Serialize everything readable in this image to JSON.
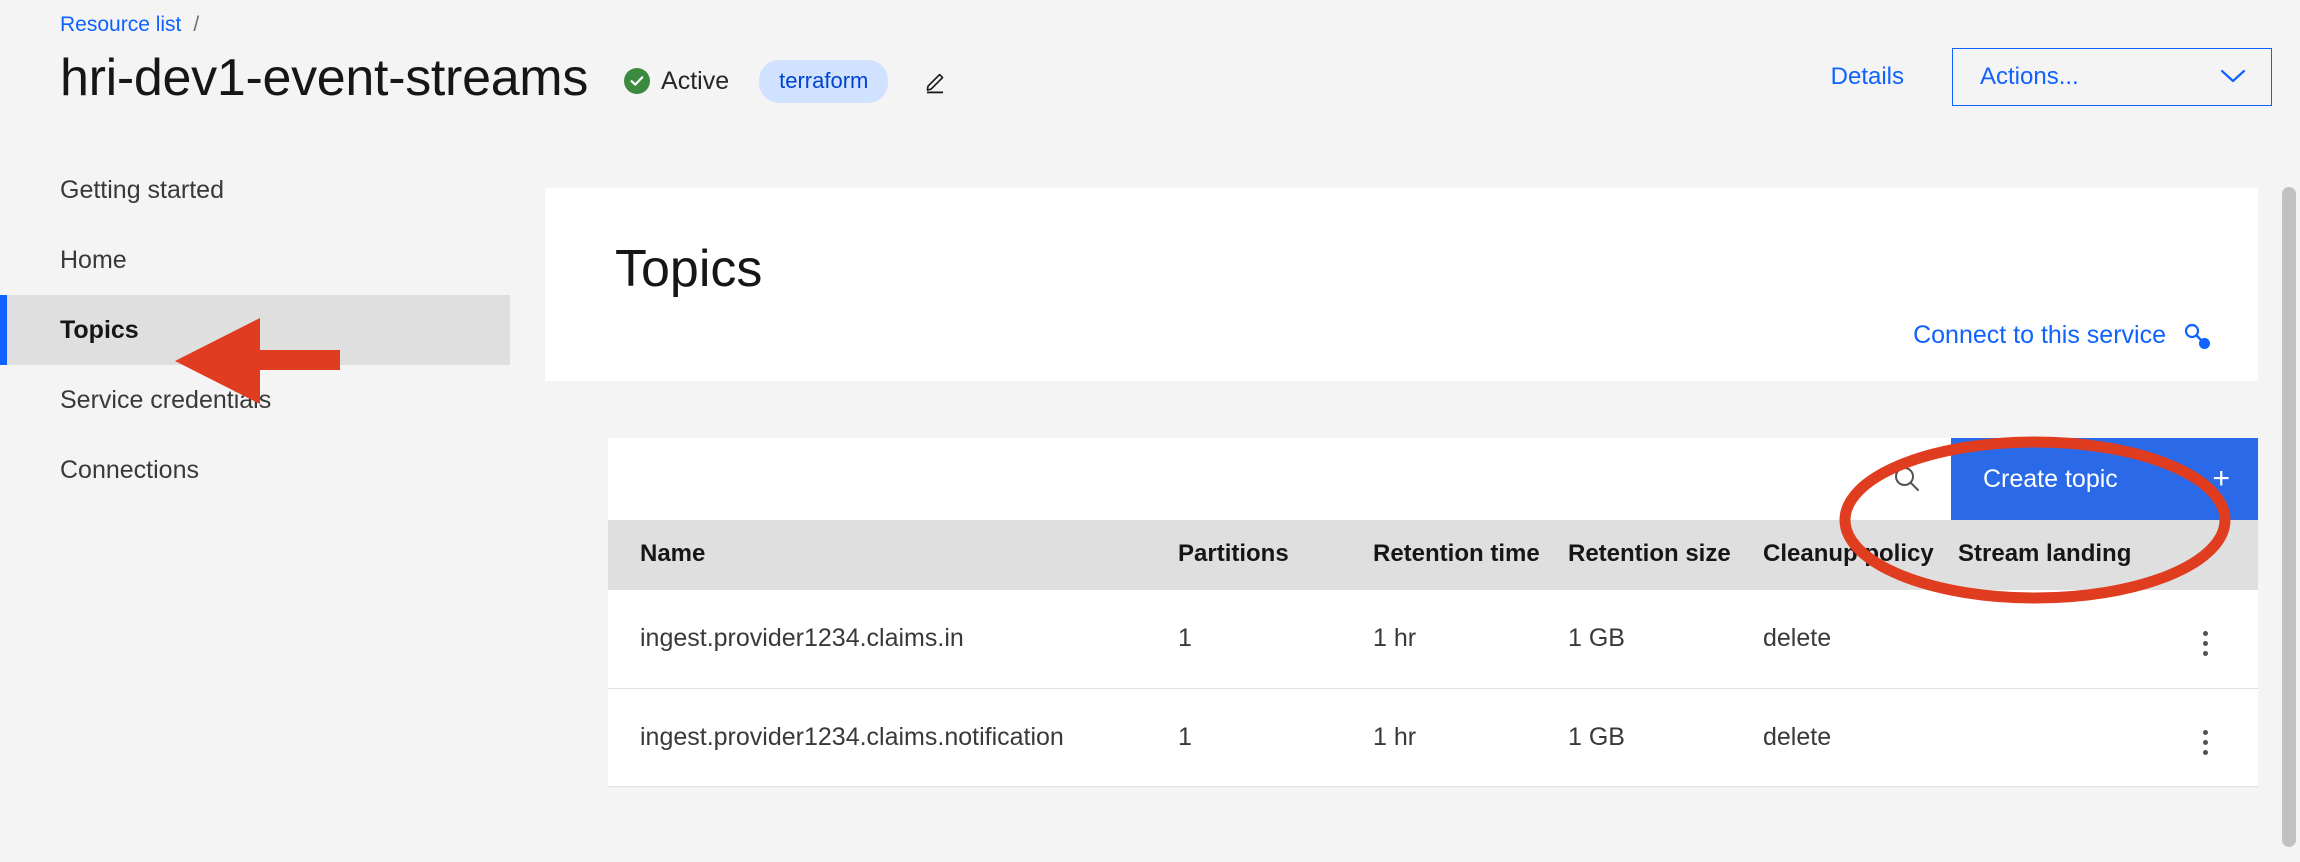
{
  "breadcrumb": {
    "link_label": "Resource list",
    "separator": "/"
  },
  "header": {
    "title": "hri-dev1-event-streams",
    "status": "Active",
    "tag": "terraform",
    "edit_icon": "pencil-icon",
    "status_icon": "check-circle-icon",
    "details_label": "Details",
    "actions_label": "Actions...",
    "actions_chevron": "chevron-down-icon",
    "accent_blue": "#0f62fe",
    "status_green": "#3b8a3f",
    "tag_bg": "#d0e2ff",
    "tag_fg": "#0043ce"
  },
  "sidebar": {
    "items": [
      {
        "label": "Getting started",
        "active": false
      },
      {
        "label": "Home",
        "active": false
      },
      {
        "label": "Topics",
        "active": true
      },
      {
        "label": "Service credentials",
        "active": false
      },
      {
        "label": "Connections",
        "active": false
      }
    ]
  },
  "main": {
    "panel_title": "Topics",
    "connect_link_label": "Connect to this service",
    "connect_icon": "connection-node-icon"
  },
  "toolbar": {
    "search_icon": "search-icon",
    "create_topic_label": "Create topic",
    "create_topic_plus": "+",
    "create_topic_bg": "#2a6ae8"
  },
  "table": {
    "columns": [
      "Name",
      "Partitions",
      "Retention time",
      "Retention size",
      "Cleanup policy",
      "Stream landing",
      ""
    ],
    "rows": [
      {
        "name": "ingest.provider1234.claims.in",
        "partitions": "1",
        "retention_time": "1 hr",
        "retention_size": "1 GB",
        "cleanup_policy": "delete",
        "stream_landing": "",
        "menu_icon": "overflow-menu-icon"
      },
      {
        "name": "ingest.provider1234.claims.notification",
        "partitions": "1",
        "retention_time": "1 hr",
        "retention_size": "1 GB",
        "cleanup_policy": "delete",
        "stream_landing": "",
        "menu_icon": "overflow-menu-icon"
      }
    ]
  },
  "annotations": {
    "color": "#e03c1f",
    "arrow_target": "Topics",
    "ellipse_target": "Create topic"
  }
}
